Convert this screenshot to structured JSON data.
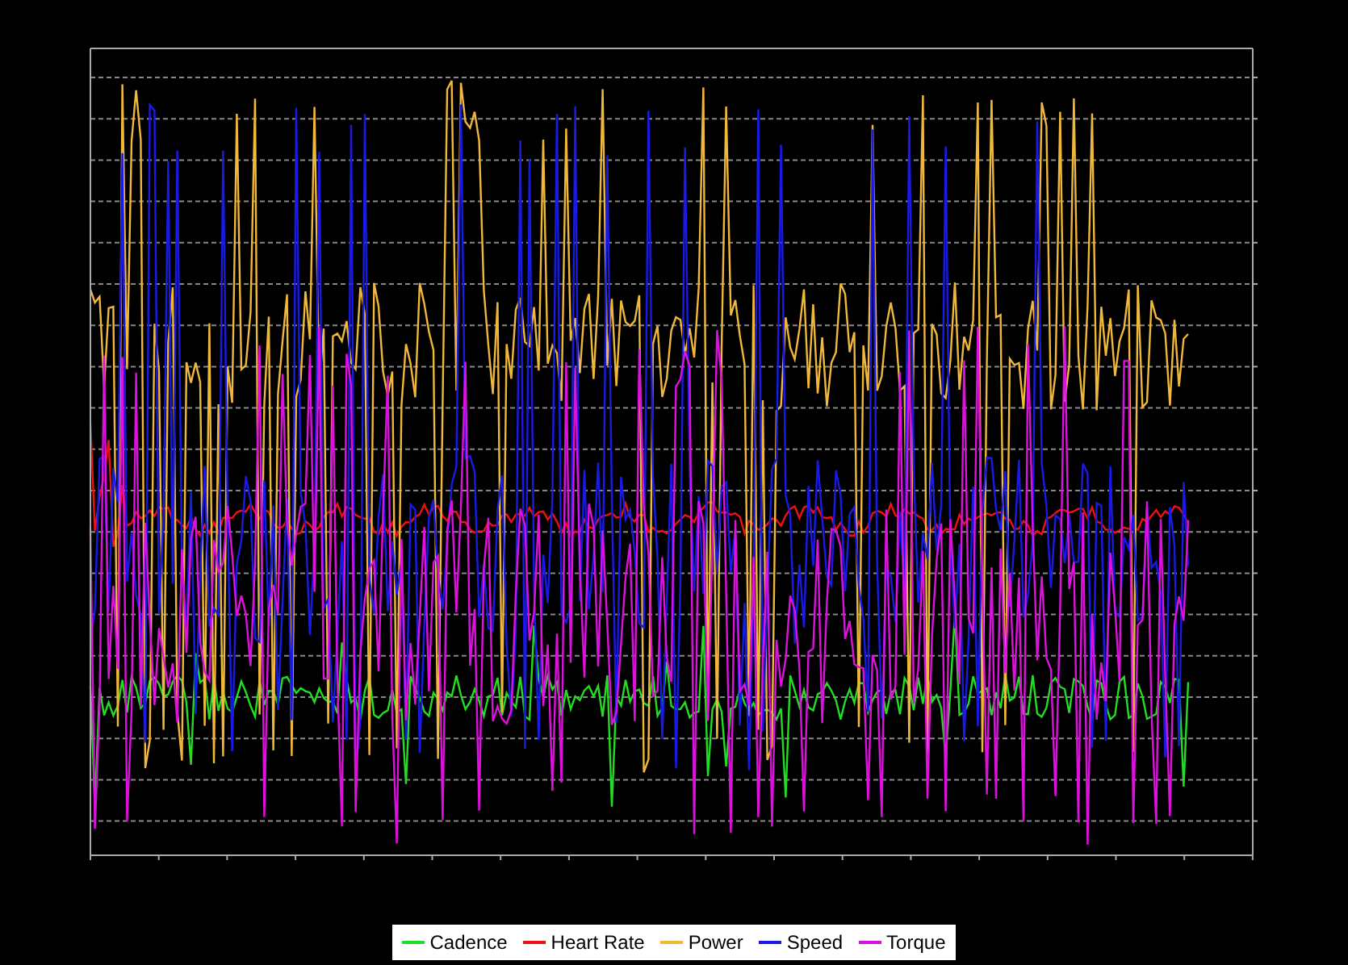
{
  "legend": {
    "items": [
      {
        "label": "Cadence",
        "color": "#22dd22"
      },
      {
        "label": "Heart Rate",
        "color": "#ee1111"
      },
      {
        "label": "Power",
        "color": "#f0b83a"
      },
      {
        "label": "Speed",
        "color": "#1a1ae6"
      },
      {
        "label": "Torque",
        "color": "#dd11dd"
      }
    ]
  }
}
